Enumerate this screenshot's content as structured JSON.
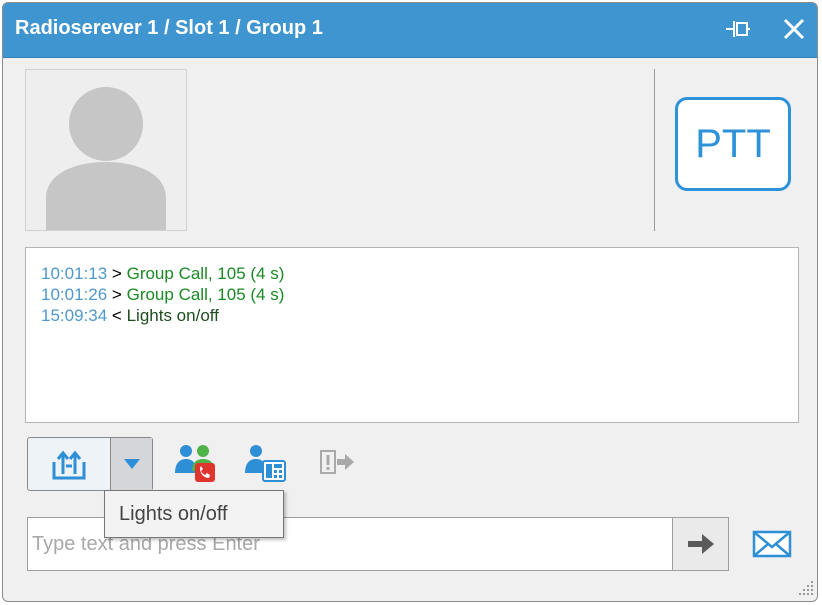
{
  "window": {
    "title": "Radioserever 1 / Slot 1 / Group 1",
    "accent_color": "#3e95d0"
  },
  "titlebar": {
    "pin_icon": "pin-icon",
    "close_icon": "close-icon"
  },
  "ptt": {
    "label": "PTT"
  },
  "log": {
    "entries": [
      {
        "time": "10:01:13",
        "direction": ">",
        "text": "Group Call, 105 (4 s)"
      },
      {
        "time": "10:01:26",
        "direction": ">",
        "text": "Group Call, 105 (4 s)"
      },
      {
        "time": "15:09:34",
        "direction": "<",
        "text": "Lights on/off"
      }
    ]
  },
  "toolbar": {
    "split_button_icon": "send-status-icon",
    "dropdown_icon": "chevron-down-icon",
    "call_icon": "group-call-icon",
    "telephone_icon": "telephone-call-icon",
    "exit_icon": "exit-icon"
  },
  "tooltip": {
    "text": "Lights on/off"
  },
  "message_input": {
    "value": "",
    "placeholder": "Type text and press Enter",
    "send_icon": "arrow-right-icon",
    "mail_icon": "envelope-icon"
  }
}
